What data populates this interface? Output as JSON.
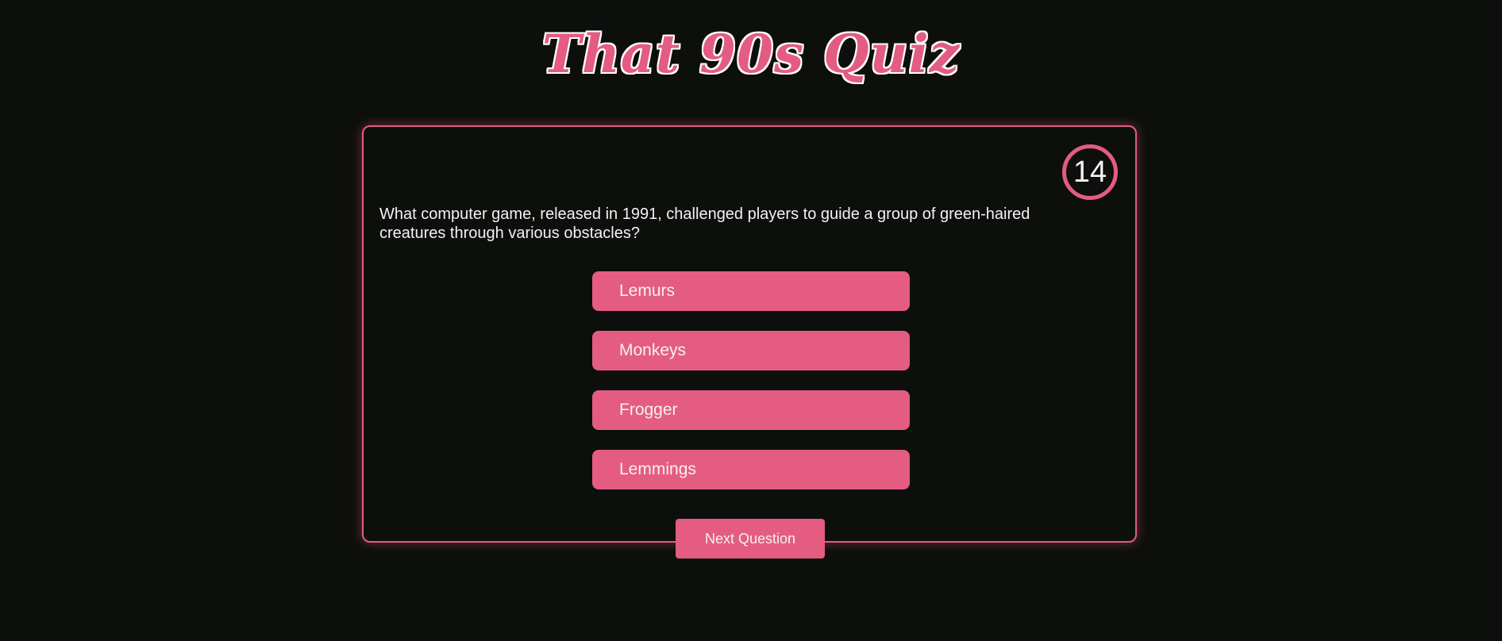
{
  "header": {
    "title": "That 90s Quiz"
  },
  "quiz": {
    "timer": "14",
    "question": "What computer game, released in 1991, challenged players to guide a group of green-haired creatures through various obstacles?",
    "answers": [
      "Lemurs",
      "Monkeys",
      "Frogger",
      "Lemmings"
    ],
    "next_label": "Next Question"
  },
  "colors": {
    "accent": "#e45c82",
    "background": "#0d0f0c",
    "text": "#f2f2f2"
  }
}
